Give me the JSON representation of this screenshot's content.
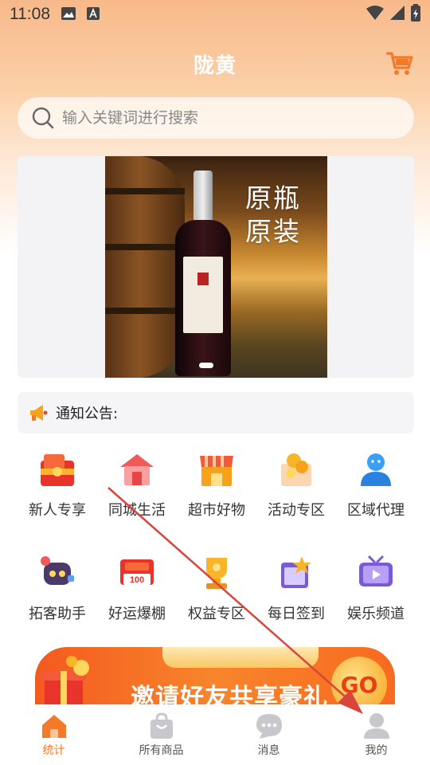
{
  "status_bar": {
    "time": "11:08"
  },
  "header": {
    "title": "陇黄"
  },
  "search": {
    "placeholder": "输入关键词进行搜索"
  },
  "banner": {
    "text_line1": "原瓶",
    "text_line2": "原装"
  },
  "notice": {
    "label": "通知公告:"
  },
  "grid": {
    "items": [
      {
        "label": "新人专享",
        "icon": "red-envelope-gift-icon"
      },
      {
        "label": "同城生活",
        "icon": "house-icon"
      },
      {
        "label": "超市好物",
        "icon": "shop-icon"
      },
      {
        "label": "活动专区",
        "icon": "coins-box-icon"
      },
      {
        "label": "区域代理",
        "icon": "agent-person-icon"
      },
      {
        "label": "拓客助手",
        "icon": "robot-chat-icon"
      },
      {
        "label": "好运爆棚",
        "icon": "lottery-100-icon"
      },
      {
        "label": "权益专区",
        "icon": "trophy-icon"
      },
      {
        "label": "每日签到",
        "icon": "calendar-star-icon"
      },
      {
        "label": "娱乐频道",
        "icon": "tv-play-icon"
      }
    ]
  },
  "invite": {
    "text": "邀请好友共享豪礼",
    "go": "GO"
  },
  "bottom_nav": {
    "items": [
      {
        "label": "统计",
        "icon": "home-icon",
        "active": true
      },
      {
        "label": "所有商品",
        "icon": "shopping-bag-icon",
        "active": false
      },
      {
        "label": "消息",
        "icon": "chat-bubble-icon",
        "active": false
      },
      {
        "label": "我的",
        "icon": "user-icon",
        "active": false
      }
    ]
  },
  "colors": {
    "accent": "#f47a2a",
    "annotation_arrow": "#d9453a"
  }
}
